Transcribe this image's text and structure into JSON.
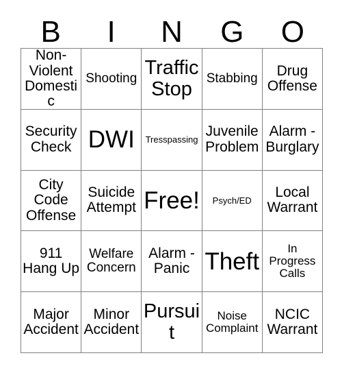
{
  "card": {
    "header_letters": [
      "B",
      "I",
      "N",
      "G",
      "O"
    ],
    "rows": [
      [
        {
          "text": "Non-Violent Domestic",
          "size": "lg"
        },
        {
          "text": "Shooting",
          "size": "md"
        },
        {
          "text": "Traffic Stop",
          "size": "xl"
        },
        {
          "text": "Stabbing",
          "size": "md"
        },
        {
          "text": "Drug Offense",
          "size": "lg"
        }
      ],
      [
        {
          "text": "Security Check",
          "size": "lg"
        },
        {
          "text": "DWI",
          "size": "xxl"
        },
        {
          "text": "Tresspassing",
          "size": "xs"
        },
        {
          "text": "Juvenile Problem",
          "size": "lg"
        },
        {
          "text": "Alarm - Burglary",
          "size": "lg"
        }
      ],
      [
        {
          "text": "City Code Offense",
          "size": "lg"
        },
        {
          "text": "Suicide Attempt",
          "size": "lg"
        },
        {
          "text": "Free!",
          "size": "xxl"
        },
        {
          "text": "Psych/ED",
          "size": "xs"
        },
        {
          "text": "Local Warrant",
          "size": "lg"
        }
      ],
      [
        {
          "text": "911 Hang Up",
          "size": "lg"
        },
        {
          "text": "Welfare Concern",
          "size": "md"
        },
        {
          "text": "Alarm - Panic",
          "size": "lg"
        },
        {
          "text": "Theft",
          "size": "xxl"
        },
        {
          "text": "In Progress Calls",
          "size": "sm"
        }
      ],
      [
        {
          "text": "Major Accident",
          "size": "lg"
        },
        {
          "text": "Minor Accident",
          "size": "lg"
        },
        {
          "text": "Pursuit",
          "size": "xl"
        },
        {
          "text": "Noise Complaint",
          "size": "sm"
        },
        {
          "text": "NCIC Warrant",
          "size": "lg"
        }
      ]
    ]
  },
  "colors": {
    "background": "#ffffff",
    "text": "#000000",
    "grid_line": "#808080"
  }
}
